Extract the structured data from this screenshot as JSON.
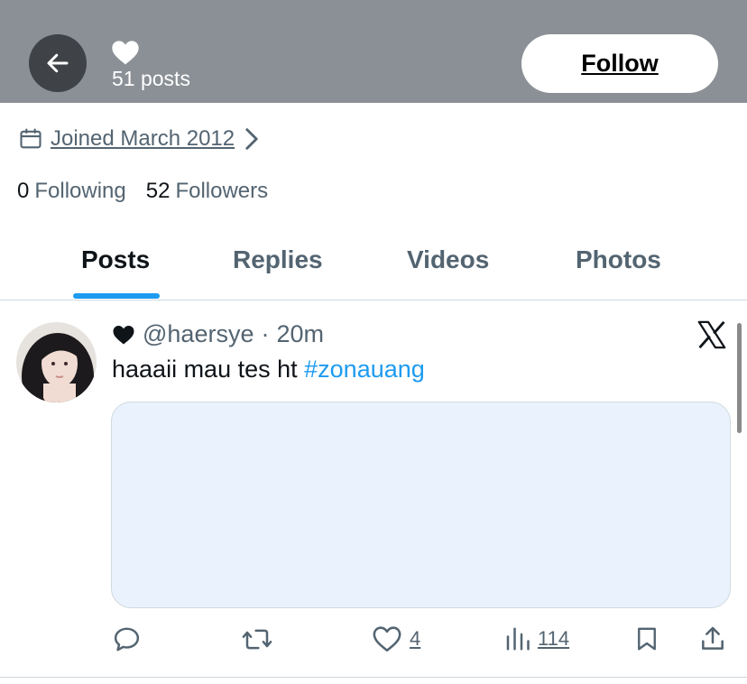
{
  "header": {
    "posts_count": "51 posts",
    "follow_label": "Follow"
  },
  "profile": {
    "joined": "Joined March 2012",
    "following_count": "0",
    "following_label": "Following",
    "followers_count": "52",
    "followers_label": "Followers"
  },
  "tabs": [
    {
      "label": "Posts",
      "active": true
    },
    {
      "label": "Replies",
      "active": false
    },
    {
      "label": "Videos",
      "active": false
    },
    {
      "label": "Photos",
      "active": false
    }
  ],
  "post": {
    "handle": "@haersye",
    "separator": "·",
    "time": "20m",
    "text": "haaaii mau tes ht",
    "hashtag": "#zonauang",
    "likes": "4",
    "views": "114"
  },
  "icons": [
    "back-arrow-icon",
    "heart-icon",
    "calendar-icon",
    "chevron-right-icon",
    "x-logo-icon",
    "reply-icon",
    "retweet-icon",
    "like-icon",
    "views-icon",
    "bookmark-icon",
    "share-icon"
  ],
  "colors": {
    "accent": "#1d9bf0",
    "header_bg": "#8b9096",
    "muted_text": "#536471",
    "media_bg": "#eaf3fd"
  }
}
